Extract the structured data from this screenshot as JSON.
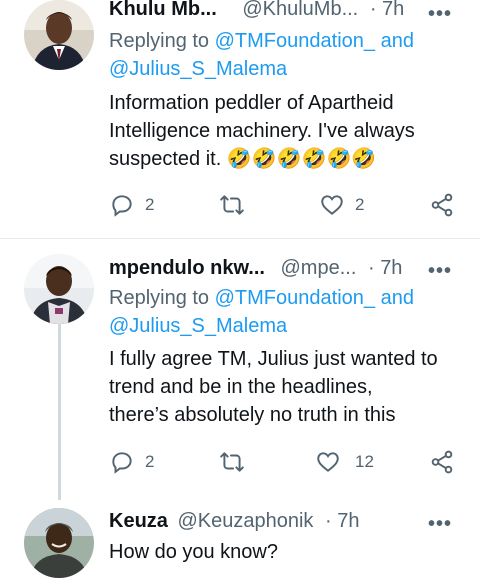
{
  "tweets": [
    {
      "name": "Khulu Mb...",
      "handle": "@KhuluMb...",
      "dot": "·",
      "time": "7h",
      "replying_to": "Replying to",
      "mention1": "@TMFoundation_",
      "and": "and",
      "mention2": "@Julius_S_Malema",
      "text_line1": "Information peddler of Apartheid",
      "text_line2": "Intelligence machinery. I've always",
      "text_line3": "suspected it. 🤣🤣🤣🤣🤣🤣",
      "replies": "2",
      "likes": "2"
    },
    {
      "name": "mpendulo nkw...",
      "handle": "@mpe...",
      "dot": "·",
      "time": "7h",
      "replying_to": "Replying to",
      "mention1": "@TMFoundation_",
      "and": "and",
      "mention2": "@Julius_S_Malema",
      "text_line1": "I fully agree TM, Julius just wanted to",
      "text_line2": "trend and be in the headlines,",
      "text_line3": "there’s absolutely no truth in this",
      "replies": "2",
      "likes": "12"
    },
    {
      "name": "Keuza",
      "handle": "@Keuzaphonik",
      "dot": "·",
      "time": "7h",
      "text_line1": "How do you know?"
    }
  ],
  "icons": {
    "reply": "reply-icon",
    "retweet": "retweet-icon",
    "like": "like-icon",
    "share": "share-icon",
    "more": "more-icon"
  },
  "colors": {
    "link": "#1d9bf0",
    "secondary": "#536471",
    "divider": "#e6ecf0"
  }
}
